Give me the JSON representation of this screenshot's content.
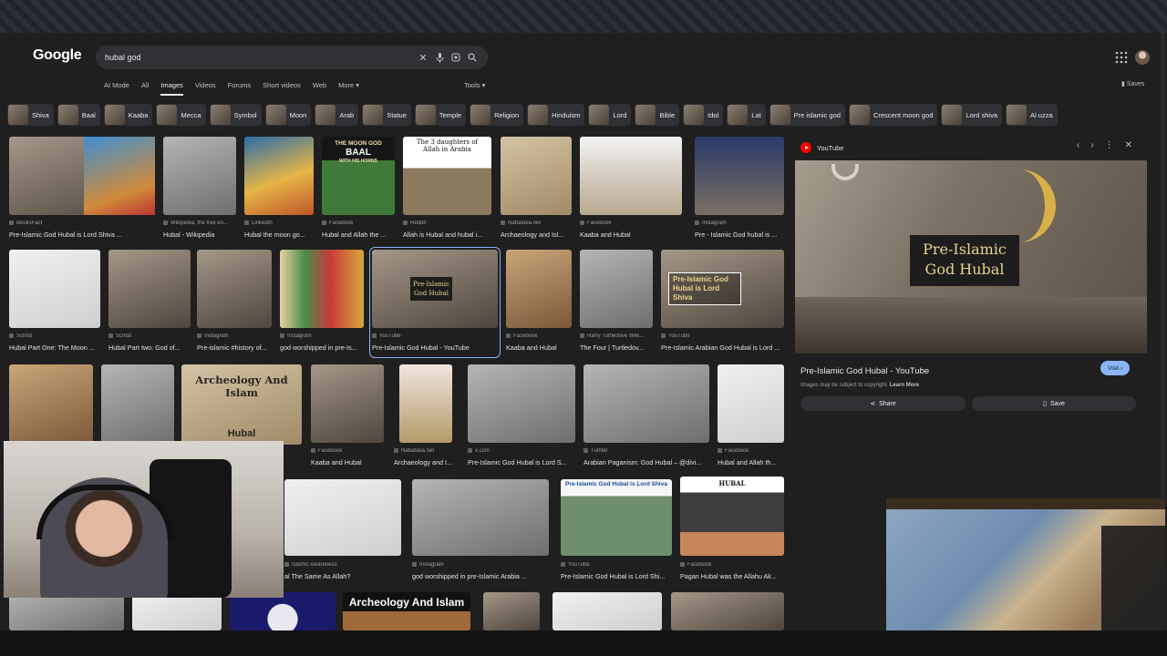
{
  "search": {
    "query": "hubal god"
  },
  "logo": "Google",
  "tabs": [
    "AI Mode",
    "All",
    "Images",
    "Videos",
    "Forums",
    "Short videos",
    "Web",
    "More"
  ],
  "tools_label": "Tools",
  "saves_label": "Saves",
  "chips": [
    "Shiva",
    "Baal",
    "Kaaba",
    "Mecca",
    "Symbol",
    "Moon",
    "Arab",
    "Statue",
    "Temple",
    "Religion",
    "Hinduism",
    "Lord",
    "Bible",
    "Idol",
    "Lat",
    "Pre islamic god",
    "Crescent moon god",
    "Lord shiva",
    "Al uzza"
  ],
  "rows": [
    [
      {
        "src": "BooksFact",
        "cap": "Pre-Islamic God Hubal is Lord Shiva ..."
      },
      {
        "src": "Wikipedia, the free en...",
        "cap": "Hubal - Wikipedia"
      },
      {
        "src": "LinkedIn",
        "cap": "Hubal the moon go..."
      },
      {
        "src": "Facebook",
        "cap": "Hubal and Allah the ..."
      },
      {
        "src": "Reddit",
        "cap": "Allah is Hubal and hubal i..."
      },
      {
        "src": "Nabataea.net",
        "cap": "Archaeology and Isl..."
      },
      {
        "src": "Facebook",
        "cap": "Kaaba and Hubal"
      },
      {
        "src": "Instagram",
        "cap": "Pre - Islamic God hubal is ..."
      }
    ],
    [
      {
        "src": "Scribd",
        "cap": "Hubal Part One: The Moon ..."
      },
      {
        "src": "Scribd",
        "cap": "Hubal Part two: God of..."
      },
      {
        "src": "Instagram",
        "cap": "Pre-islamic #history of..."
      },
      {
        "src": "Instagram",
        "cap": "god worshipped in pre-Is..."
      },
      {
        "src": "YouTube",
        "cap": "Pre-Islamic God Hubal - YouTube"
      },
      {
        "src": "Facebook",
        "cap": "Kaaba and Hubal"
      },
      {
        "src": "Harry Turtledove Wiki...",
        "cap": "The Four | Turtledov..."
      },
      {
        "src": "YouTube",
        "cap": "Pre-Islamic Arabian God Hubal is Lord ..."
      }
    ],
    [
      {
        "src": "Facebook",
        "cap": "Kaaba and Hubal"
      },
      {
        "src": "Nabataea.net",
        "cap": "Archaeology and I..."
      },
      {
        "src": "x.com",
        "cap": "Pre-Islamic God Hubal is Lord S..."
      },
      {
        "src": "Tumblr",
        "cap": "Arabian Paganism: God Hubal – @divi..."
      },
      {
        "src": "Facebook",
        "cap": "Hubal and Allah th..."
      }
    ],
    [
      {
        "src": "Islamic Awareness",
        "cap": "al The Same As Allah?"
      },
      {
        "src": "Instagram",
        "cap": "god worshipped in pre-Islamic Arabia ..."
      },
      {
        "src": "YouTube",
        "cap": "Pre-Islamic God Hubal is Lord Shi..."
      },
      {
        "src": "Facebook",
        "cap": "Pagan Hubal was the Allahu Ak..."
      }
    ]
  ],
  "image_texts": {
    "moon_god": "THE MOON GOD",
    "baal": "BAAL",
    "with_horns": "WITH HIS HORNS",
    "daughters": "The 3 daughters of Allah in Arabia",
    "archeology": "Archeology And Islam",
    "hubal_word": "Hubal",
    "hubal_caps": "HUBAL",
    "pre_islamic_thumb": "Pre-Islamic God Hubal is Lord Shiva",
    "shiva_banner": "Pre-Islamic God Hubal is Lord Shiva",
    "archeology_bottom": "Archeology And Islam"
  },
  "panel": {
    "source": "YouTube",
    "image_title_line1": "Pre-Islamic",
    "image_title_line2": "God Hubal",
    "title": "Pre-Islamic God Hubal - YouTube",
    "copyright": "Images may be subject to copyright.",
    "learn_more": "Learn More",
    "visit": "Visit",
    "share": "Share",
    "save": "Save"
  }
}
